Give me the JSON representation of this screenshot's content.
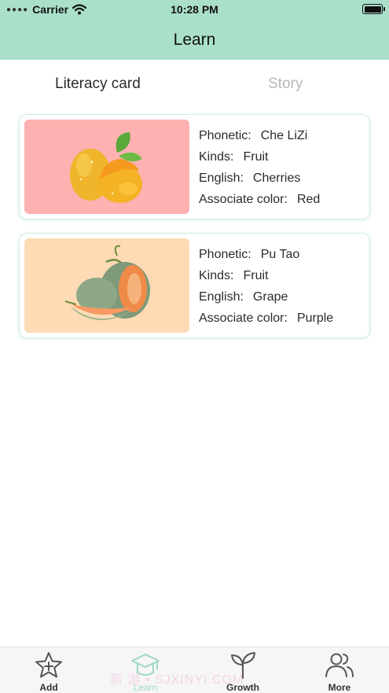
{
  "status_bar": {
    "carrier": "Carrier",
    "time": "10:28 PM",
    "icons": [
      "signal-dots-icon",
      "wifi-icon",
      "battery-icon"
    ]
  },
  "nav": {
    "title": "Learn",
    "background": "#aadfca"
  },
  "tabs": [
    {
      "label": "Literacy card",
      "active": true
    },
    {
      "label": "Story",
      "active": false
    }
  ],
  "cards": [
    {
      "image": "mango-image",
      "image_bg": "#fdb1b1",
      "phonetic_label": "Phonetic:",
      "phonetic": "Che LiZi",
      "kinds_label": "Kinds:",
      "kinds": "Fruit",
      "english_label": "English:",
      "english": "Cherries",
      "color_label": "Associate color:",
      "color": "Red"
    },
    {
      "image": "melon-image",
      "image_bg": "#fedbb4",
      "phonetic_label": "Phonetic:",
      "phonetic": "Pu Tao",
      "kinds_label": "Kinds:",
      "kinds": "Fruit",
      "english_label": "English:",
      "english": "Grape",
      "color_label": "Associate color:",
      "color": "Purple"
    }
  ],
  "tab_bar": {
    "items": [
      {
        "label": "Add",
        "icon": "star-plus-icon",
        "current": false
      },
      {
        "label": "Learn",
        "icon": "graduation-cap-icon",
        "current": true
      },
      {
        "label": "Growth",
        "icon": "sprout-icon",
        "current": false
      },
      {
        "label": "More",
        "icon": "users-icon",
        "current": false
      }
    ],
    "watermark": "新 游 • SJXINYI.COM"
  }
}
